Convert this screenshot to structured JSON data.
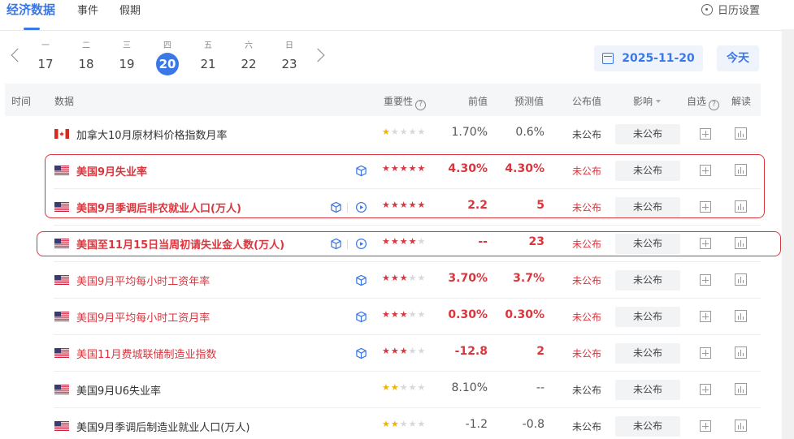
{
  "tabs": [
    {
      "label": "经济数据",
      "active": true
    },
    {
      "label": "事件",
      "active": false
    },
    {
      "label": "假期",
      "active": false
    }
  ],
  "calendar_settings_label": "日历设置",
  "date_strip": {
    "days": [
      {
        "weekday": "一",
        "day": "17",
        "selected": false
      },
      {
        "weekday": "二",
        "day": "18",
        "selected": false
      },
      {
        "weekday": "三",
        "day": "19",
        "selected": false
      },
      {
        "weekday": "四",
        "day": "20",
        "selected": true
      },
      {
        "weekday": "五",
        "day": "21",
        "selected": false
      },
      {
        "weekday": "六",
        "day": "22",
        "selected": false
      },
      {
        "weekday": "日",
        "day": "23",
        "selected": false
      }
    ],
    "date_value": "2025-11-20",
    "today_label": "今天"
  },
  "table": {
    "headers": {
      "time": "时间",
      "data": "数据",
      "importance": "重要性",
      "previous": "前值",
      "forecast": "预测值",
      "published": "公布值",
      "impact": "影响",
      "watchlist": "自选",
      "interpretation": "解读"
    },
    "rows": [
      {
        "country": "canada",
        "name": "加拿大10月原材料价格指数月率",
        "stars": 1,
        "previous": "1.70%",
        "forecast": "0.6%",
        "published": "未公布",
        "impact": "未公布",
        "color": "dark",
        "bold": false,
        "icons": []
      },
      {
        "country": "us",
        "name": "美国9月失业率",
        "stars": 5,
        "previous": "4.30%",
        "forecast": "4.30%",
        "published": "未公布",
        "impact": "未公布",
        "color": "red",
        "bold": true,
        "icons": [
          "cube-icon"
        ]
      },
      {
        "country": "us",
        "name": "美国9月季调后非农就业人口(万人)",
        "stars": 5,
        "previous": "2.2",
        "forecast": "5",
        "published": "未公布",
        "impact": "未公布",
        "color": "red",
        "bold": true,
        "icons": [
          "cube-icon",
          "play-icon"
        ]
      },
      {
        "country": "us",
        "name": "美国至11月15日当周初请失业金人数(万人)",
        "stars": 4,
        "previous": "--",
        "forecast": "23",
        "published": "未公布",
        "impact": "未公布",
        "color": "red",
        "bold": true,
        "icons": [
          "cube-icon",
          "play-icon"
        ]
      },
      {
        "country": "us",
        "name": "美国9月平均每小时工资年率",
        "stars": 3,
        "previous": "3.70%",
        "forecast": "3.7%",
        "published": "未公布",
        "impact": "未公布",
        "color": "red",
        "bold": false,
        "icons": [
          "cube-icon"
        ]
      },
      {
        "country": "us",
        "name": "美国9月平均每小时工资月率",
        "stars": 3,
        "previous": "0.30%",
        "forecast": "0.30%",
        "published": "未公布",
        "impact": "未公布",
        "color": "red",
        "bold": false,
        "icons": [
          "cube-icon"
        ]
      },
      {
        "country": "us",
        "name": "美国11月费城联储制造业指数",
        "stars": 3,
        "previous": "-12.8",
        "forecast": "2",
        "published": "未公布",
        "impact": "未公布",
        "color": "red",
        "bold": false,
        "icons": [
          "cube-icon"
        ]
      },
      {
        "country": "us",
        "name": "美国9月U6失业率",
        "stars": 2,
        "previous": "8.10%",
        "forecast": "--",
        "published": "未公布",
        "impact": "未公布",
        "color": "dark",
        "bold": false,
        "icons": []
      },
      {
        "country": "us",
        "name": "美国9月季调后制造业就业人口(万人)",
        "stars": 2,
        "previous": "-1.2",
        "forecast": "-0.8",
        "published": "未公布",
        "impact": "未公布",
        "color": "dark",
        "bold": false,
        "icons": []
      }
    ]
  },
  "colors": {
    "accent": "#3b78e7",
    "highlight": "#d9363e",
    "star": "#f0b400"
  }
}
